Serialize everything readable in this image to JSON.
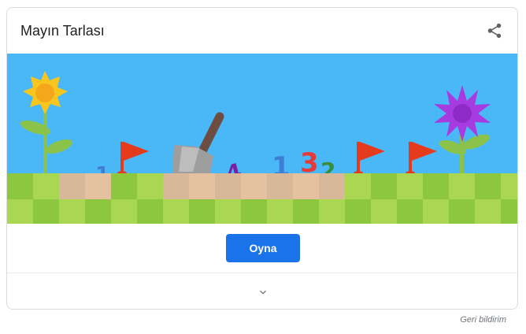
{
  "card": {
    "title": "Mayın Tarlası",
    "share_icon": "share-icon",
    "play_label": "Oyna",
    "expand_icon": "chevron-down-icon"
  },
  "banner": {
    "numbers": [
      "1",
      "1",
      "4",
      "1",
      "3",
      "2"
    ]
  },
  "feedback_label": "Geri bildirim",
  "colors": {
    "sky": "#4ab7f7",
    "grass_light": "#aad751",
    "grass_dark": "#8dc63f",
    "dirt_light": "#e5c29f",
    "dirt_dark": "#d7b899",
    "flag": "#e53a1b",
    "button": "#1a73e8"
  }
}
